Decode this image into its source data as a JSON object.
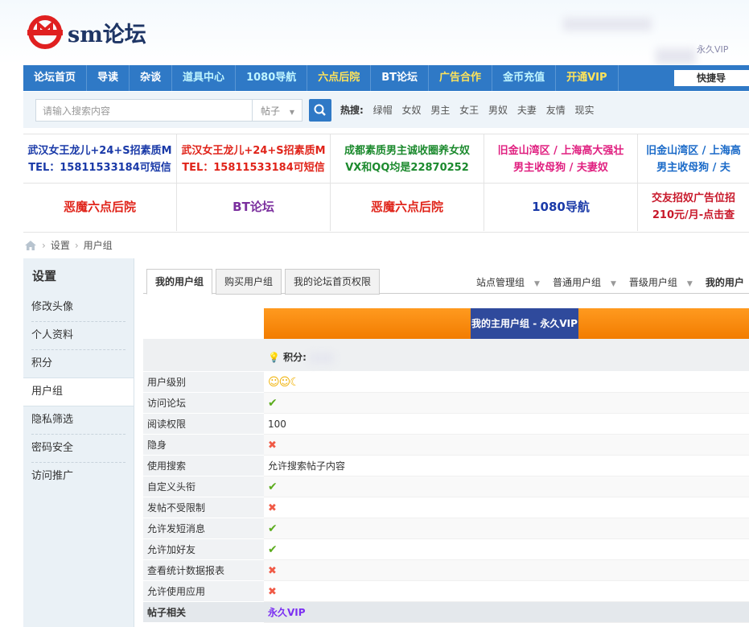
{
  "site": {
    "logo_text": "sm论坛",
    "vip_badge": "永久VIP"
  },
  "nav": {
    "items": [
      {
        "label": "论坛首页",
        "color": "#ffffff"
      },
      {
        "label": "导读",
        "color": "#ffffff"
      },
      {
        "label": "杂谈",
        "color": "#ffffff"
      },
      {
        "label": "道具中心",
        "color": "#bff5ff"
      },
      {
        "label": "1080导航",
        "color": "#bff5ff"
      },
      {
        "label": "六点后院",
        "color": "#ffe45a"
      },
      {
        "label": "BT论坛",
        "color": "#ffffff"
      },
      {
        "label": "广告合作",
        "color": "#ffe45a"
      },
      {
        "label": "金币充值",
        "color": "#bff5ff"
      },
      {
        "label": "开通VIP",
        "color": "#ffe45a"
      }
    ],
    "quick": "快捷导"
  },
  "search": {
    "placeholder": "请输入搜索内容",
    "scope": "帖子",
    "hot_label": "热搜:",
    "hot": [
      "绿帽",
      "女奴",
      "男主",
      "女王",
      "男奴",
      "夫妻",
      "友情",
      "现实"
    ]
  },
  "ads": {
    "row1": [
      {
        "l1": "武汉女王龙儿+24+S招素质M",
        "l2": "TEL：15811533184可短信",
        "color": "#1a3aa8"
      },
      {
        "l1": "武汉女王龙儿+24+S招素质M",
        "l2": "TEL：15811533184可短信",
        "color": "#e0241a"
      },
      {
        "l1": "成都素质男主诚收圈养女奴",
        "l2": "VX和QQ均是22870252",
        "color": "#1c8a2e"
      },
      {
        "l1": "旧金山湾区 / 上海高大强壮",
        "l2": "男主收母狗 / 夫妻奴",
        "color": "#e02080"
      },
      {
        "l1": "旧金山湾区 / 上海高",
        "l2": "男主收母狗 / 夫",
        "color": "#1a6ac8"
      }
    ],
    "row2": [
      {
        "l1": "恶魔六点后院",
        "l2": "",
        "color": "#e0241a"
      },
      {
        "l1": "BT论坛",
        "l2": "",
        "color": "#7b2f9e"
      },
      {
        "l1": "恶魔六点后院",
        "l2": "",
        "color": "#e0241a"
      },
      {
        "l1": "1080导航",
        "l2": "",
        "color": "#1a3aa8"
      },
      {
        "l1": "交友招奴广告位招",
        "l2": "210元/月-点击查",
        "color": "#c8182a"
      }
    ]
  },
  "breadcrumb": {
    "items": [
      "设置",
      "用户组"
    ]
  },
  "sidebar": {
    "title": "设置",
    "items": [
      "修改头像",
      "个人资料",
      "积分",
      "用户组",
      "隐私筛选",
      "密码安全",
      "访问推广"
    ],
    "active": "用户组"
  },
  "tabs": {
    "items": [
      "我的用户组",
      "购买用户组",
      "我的论坛首页权限"
    ],
    "right": [
      "站点管理组",
      "普通用户组",
      "晋级用户组",
      "我的用户"
    ]
  },
  "group": {
    "banner": "我的主用户组 - 永久VIP",
    "points_label": "积分: "
  },
  "permissions": [
    {
      "label": "用户级别",
      "value": "☺☺☾",
      "type": "level"
    },
    {
      "label": "访问论坛",
      "value": "✔",
      "type": "yes"
    },
    {
      "label": "阅读权限",
      "value": "100",
      "type": "text"
    },
    {
      "label": "隐身",
      "value": "✖",
      "type": "no"
    },
    {
      "label": "使用搜索",
      "value": "允许搜索帖子内容",
      "type": "text"
    },
    {
      "label": "自定义头衔",
      "value": "✔",
      "type": "yes"
    },
    {
      "label": "发帖不受限制",
      "value": "✖",
      "type": "no"
    },
    {
      "label": "允许发短消息",
      "value": "✔",
      "type": "yes"
    },
    {
      "label": "允许加好友",
      "value": "✔",
      "type": "yes"
    },
    {
      "label": "查看统计数据报表",
      "value": "✖",
      "type": "no"
    },
    {
      "label": "允许使用应用",
      "value": "✖",
      "type": "no"
    },
    {
      "label": "帖子相关",
      "value": "永久VIP",
      "type": "vip"
    }
  ]
}
